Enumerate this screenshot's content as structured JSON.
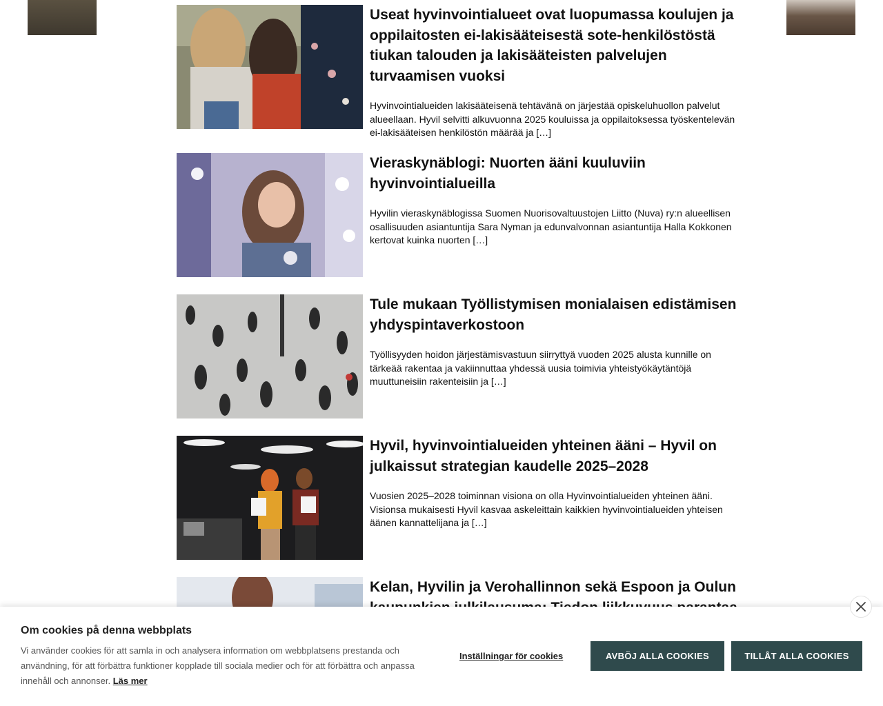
{
  "articles": [
    {
      "title": "Useat hyvinvointialueet ovat luopumassa koulujen ja oppilaitosten ei-lakisääteisestä sote-henkilöstöstä tiukan talouden ja lakisääteisten palvelujen turvaamisen vuoksi",
      "excerpt": "Hyvinvointialueiden lakisääteisenä tehtävänä on järjestää opiskeluhuollon palvelut alueellaan. Hyvil selvitti alkuvuonna 2025 kouluissa ja oppilaitoksessa työskentelevän ei-lakisääteisen henkilöstön määrää ja […]"
    },
    {
      "title": "Vieraskynäblogi: Nuorten ääni kuuluviin hyvinvointialueilla",
      "excerpt": "Hyvilin vieraskynäblogissa Suomen Nuorisovaltuustojen Liitto (Nuva) ry:n alueellisen osallisuuden asiantuntija Sara Nyman ja edunvalvonnan asiantuntija Halla Kokkonen kertovat kuinka nuorten […]"
    },
    {
      "title": "Tule mukaan Työllistymisen monialaisen edistämisen yhdyspintaverkostoon",
      "excerpt": "Työllisyyden hoidon järjestämisvastuun siirryttyä vuoden 2025 alusta kunnille on tärkeää rakentaa ja vakiinnuttaa yhdessä uusia toimivia yhteistyökäytäntöjä muuttuneisiin rakenteisiin ja […]"
    },
    {
      "title": "Hyvil, hyvinvointialueiden yhteinen ääni – Hyvil on julkaissut strategian kaudelle 2025–2028",
      "excerpt": "Vuosien 2025–2028 toiminnan visiona on olla Hyvinvointialueiden yhteinen ääni. Visionsa mukaisesti Hyvil kasvaa askeleittain kaikkien hyvinvointialueiden yhteisen äänen kannattelijana ja […]"
    },
    {
      "title": "Kelan, Hyvilin ja Verohallinnon sekä Espoon ja Oulun kaupunkien julkilausuma: Tiedon liikkuvuus parantaa",
      "excerpt": ""
    }
  ],
  "cookie_banner": {
    "title": "Om cookies på denna webbplats",
    "text": "Vi använder cookies för att samla in och analysera information om webbplatsens prestanda och användning, för att förbättra funktioner kopplade till sociala medier och för att förbättra och anpassa innehåll och annonser.",
    "read_more": "Läs mer",
    "settings_label": "Inställningar för cookies",
    "reject_label": "AVBÖJ ALLA COOKIES",
    "accept_label": "TILLÅT ALLA COOKIES",
    "close_icon": "close-icon"
  },
  "colors": {
    "button_bg": "#2f4a4c",
    "button_text": "#ffffff"
  }
}
